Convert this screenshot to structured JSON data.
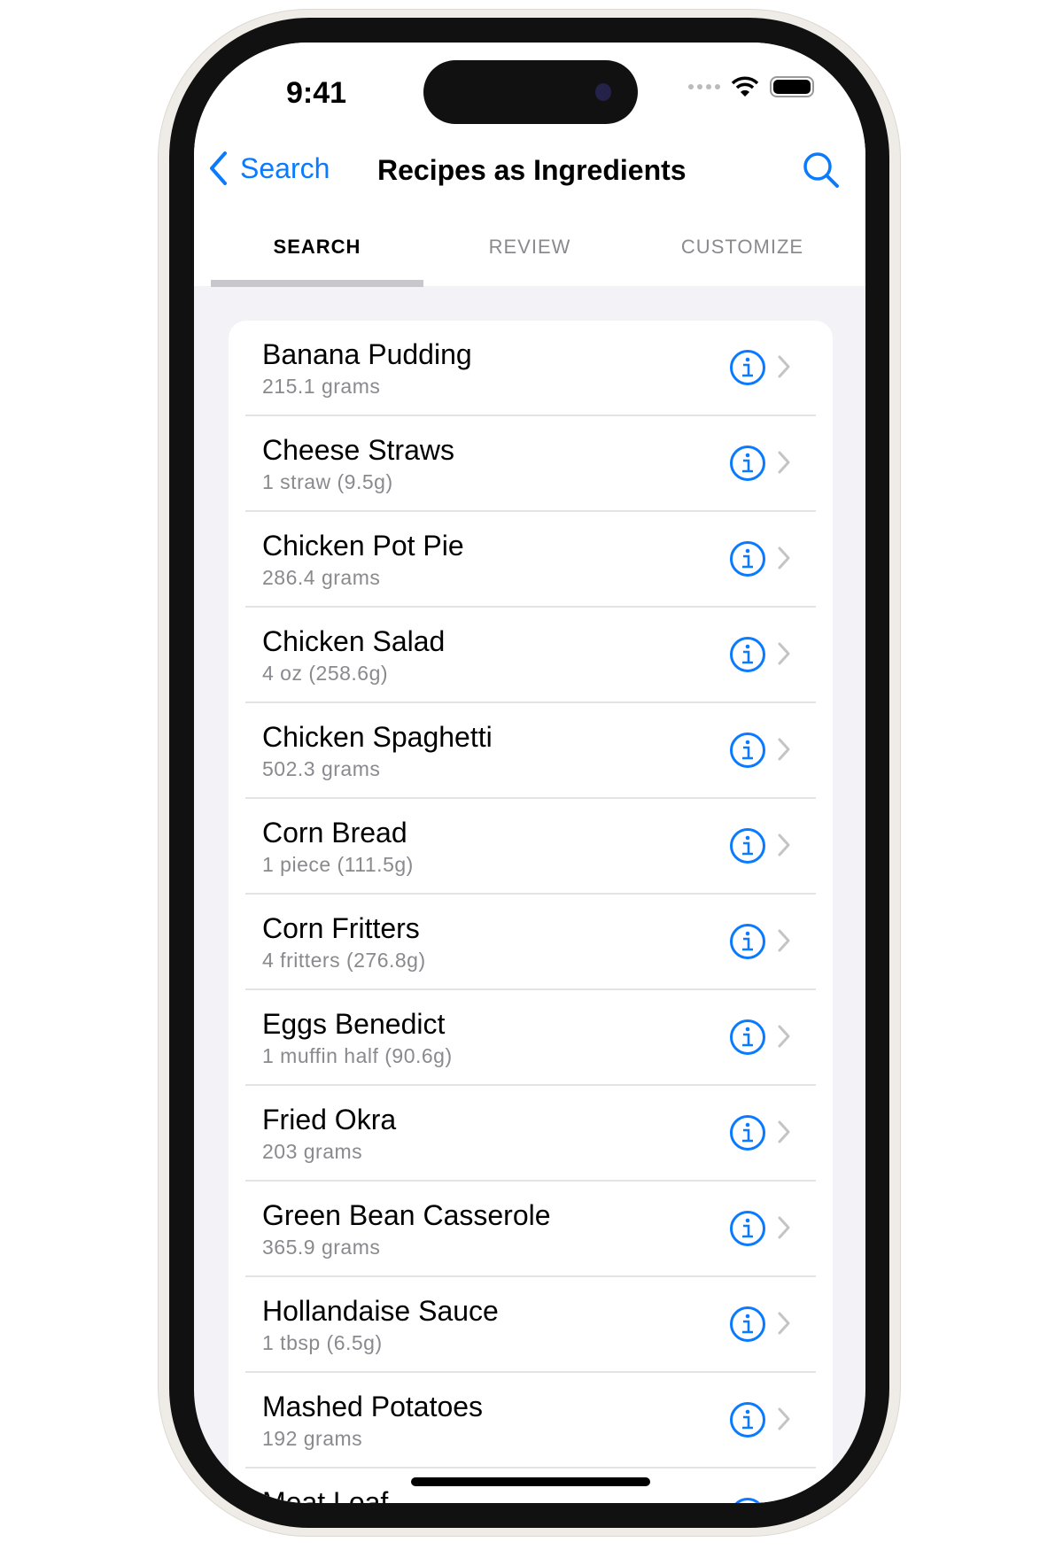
{
  "status": {
    "time": "9:41"
  },
  "nav": {
    "back_label": "Search",
    "title": "Recipes as Ingredients"
  },
  "tabs": [
    {
      "label": "SEARCH",
      "active": true
    },
    {
      "label": "REVIEW",
      "active": false
    },
    {
      "label": "CUSTOMIZE",
      "active": false
    }
  ],
  "accent": "#0a7aff",
  "items": [
    {
      "name": "Banana Pudding",
      "serving": "215.1 grams"
    },
    {
      "name": "Cheese Straws",
      "serving": "1 straw (9.5g)"
    },
    {
      "name": "Chicken Pot Pie",
      "serving": "286.4 grams"
    },
    {
      "name": "Chicken Salad",
      "serving": "4 oz (258.6g)"
    },
    {
      "name": "Chicken Spaghetti",
      "serving": "502.3 grams"
    },
    {
      "name": "Corn Bread",
      "serving": "1 piece (111.5g)"
    },
    {
      "name": "Corn Fritters",
      "serving": "4 fritters (276.8g)"
    },
    {
      "name": "Eggs Benedict",
      "serving": "1 muffin half (90.6g)"
    },
    {
      "name": "Fried Okra",
      "serving": "203 grams"
    },
    {
      "name": "Green Bean Casserole",
      "serving": "365.9 grams"
    },
    {
      "name": "Hollandaise Sauce",
      "serving": "1 tbsp (6.5g)"
    },
    {
      "name": "Mashed Potatoes",
      "serving": "192 grams"
    },
    {
      "name": "Meat Loaf",
      "serving": ""
    }
  ]
}
